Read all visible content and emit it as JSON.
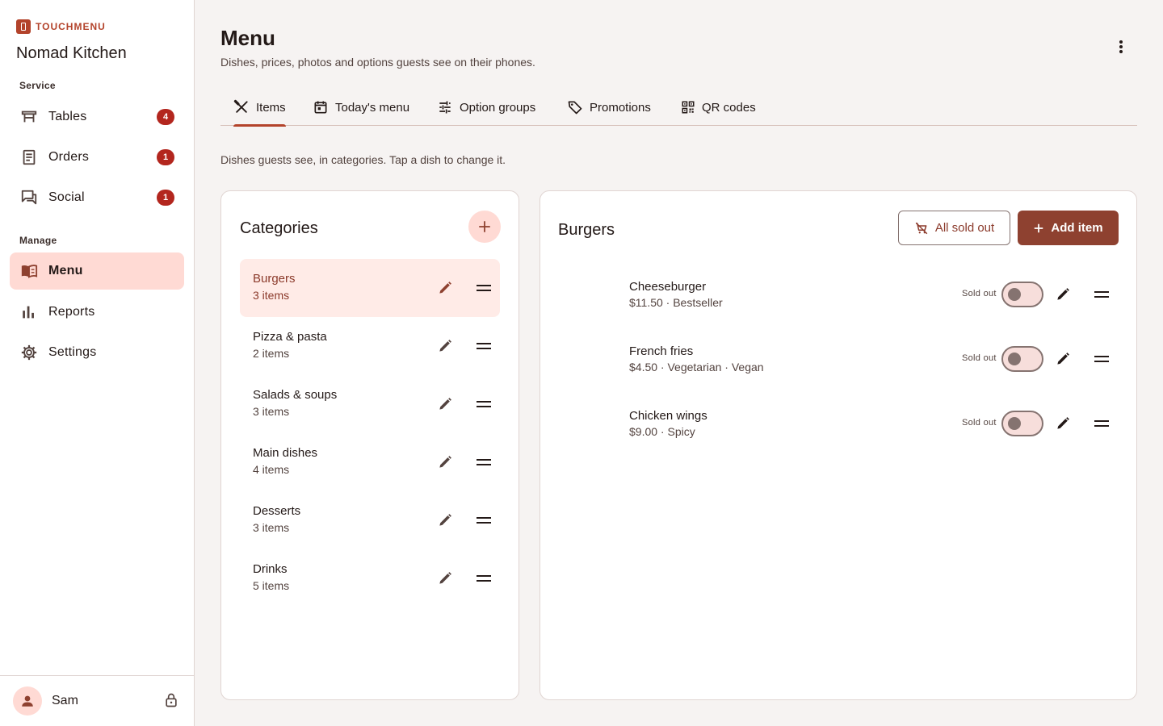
{
  "brand": {
    "name": "TOUCHMENU",
    "restaurant": "Nomad Kitchen"
  },
  "sidebar": {
    "sections": [
      {
        "label": "Service"
      },
      {
        "label": "Manage"
      }
    ],
    "items": [
      {
        "label": "Tables",
        "icon": "table-icon",
        "badge": "4"
      },
      {
        "label": "Orders",
        "icon": "receipt-icon",
        "badge": "1"
      },
      {
        "label": "Social",
        "icon": "chat-icon",
        "badge": "1"
      },
      {
        "label": "Menu",
        "icon": "menu-book-icon",
        "active": true
      },
      {
        "label": "Reports",
        "icon": "bar-chart-icon"
      },
      {
        "label": "Settings",
        "icon": "gear-icon"
      }
    ],
    "user": {
      "name": "Sam"
    }
  },
  "header": {
    "title": "Menu",
    "subtitle": "Dishes, prices, photos and options guests see on their phones."
  },
  "tabs": [
    {
      "label": "Items",
      "icon": "cutlery-icon",
      "active": true
    },
    {
      "label": "Today's menu",
      "icon": "calendar-icon"
    },
    {
      "label": "Option groups",
      "icon": "tune-icon"
    },
    {
      "label": "Promotions",
      "icon": "tag-icon"
    },
    {
      "label": "QR codes",
      "icon": "qr-code-icon"
    }
  ],
  "helper_text": "Dishes guests see, in categories. Tap a dish to change it.",
  "categories": {
    "title": "Categories",
    "list": [
      {
        "name": "Burgers",
        "count": "3 items",
        "active": true
      },
      {
        "name": "Pizza & pasta",
        "count": "2 items"
      },
      {
        "name": "Salads & soups",
        "count": "3 items"
      },
      {
        "name": "Main dishes",
        "count": "4 items"
      },
      {
        "name": "Desserts",
        "count": "3 items"
      },
      {
        "name": "Drinks",
        "count": "5 items"
      }
    ]
  },
  "items_panel": {
    "title": "Burgers",
    "all_sold_out_label": "All sold out",
    "add_item_label": "Add item",
    "sold_out_label": "Sold out",
    "items": [
      {
        "name": "Cheeseburger",
        "meta": "$11.50 · Bestseller"
      },
      {
        "name": "French fries",
        "meta": "$4.50 · Vegetarian · Vegan"
      },
      {
        "name": "Chicken wings",
        "meta": "$9.00 · Spicy"
      }
    ]
  },
  "colors": {
    "accent": "#b3432b",
    "primary_button": "#8e4130",
    "active_bg": "#ffdad4",
    "badge": "#b3261e"
  }
}
